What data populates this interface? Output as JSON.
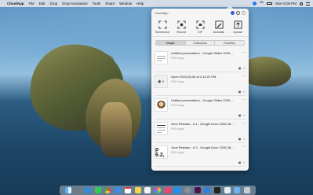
{
  "menubar": {
    "app_name": "CloudApp",
    "menus": [
      "File",
      "Edit",
      "Drop",
      "Drop Annotation",
      "Tools",
      "Share",
      "Window",
      "Help"
    ],
    "clock": "Mon 5:05 PM"
  },
  "panel": {
    "title": "CloudApp",
    "actions": [
      {
        "label": "Screenshot",
        "icon": "screenshot-icon"
      },
      {
        "label": "Record",
        "icon": "record-icon"
      },
      {
        "label": "GIF",
        "icon": "gif-icon"
      },
      {
        "label": "Annotate",
        "icon": "annotate-icon"
      },
      {
        "label": "Upload",
        "icon": "upload-icon"
      }
    ],
    "tabs": [
      {
        "label": "Drops",
        "active": true
      },
      {
        "label": "Collections",
        "active": false
      },
      {
        "label": "Favorites",
        "active": false
      }
    ],
    "drops": [
      {
        "title": "Untitled presentation - Google Slides 2020-...",
        "type": "PNG Image",
        "thumb": "doc"
      },
      {
        "title": "Open 2020-08-08 at 4.16.22 PM",
        "type": "PNG Image",
        "thumb": "camera"
      },
      {
        "title": "Untitled presentation - Google Slides 2020-08-...",
        "type": "PNG Image",
        "thumb": "avatar"
      },
      {
        "title": "June Release - 6.1 - Google Docs 2020-08-...",
        "type": "PNG Image",
        "thumb": "doc"
      },
      {
        "title": "June Release - 6.2 - Google Docs 2020-08-...",
        "type": "PNG Image",
        "thumb": "p62",
        "thumb_text": "p 6.2,"
      }
    ]
  },
  "colors": {
    "accent": "#2b7de9",
    "panel_bg": "#f5f5f6"
  }
}
